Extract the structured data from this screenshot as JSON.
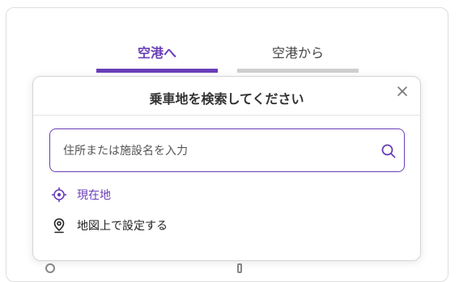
{
  "tabs": [
    {
      "label": "空港へ",
      "active": true
    },
    {
      "label": "空港から",
      "active": false
    }
  ],
  "modal": {
    "title": "乗車地を検索してください",
    "close_icon": "close-icon",
    "search": {
      "placeholder": "住所または施設名を入力",
      "value": "",
      "icon": "search-icon"
    },
    "options": [
      {
        "label": "現在地",
        "icon": "location-target-icon"
      },
      {
        "label": "地図上で設定する",
        "icon": "map-pin-icon"
      }
    ]
  },
  "colors": {
    "accent": "#6a3fb8",
    "inactive_tab_underline": "#cfcfcf",
    "text": "#333333"
  }
}
